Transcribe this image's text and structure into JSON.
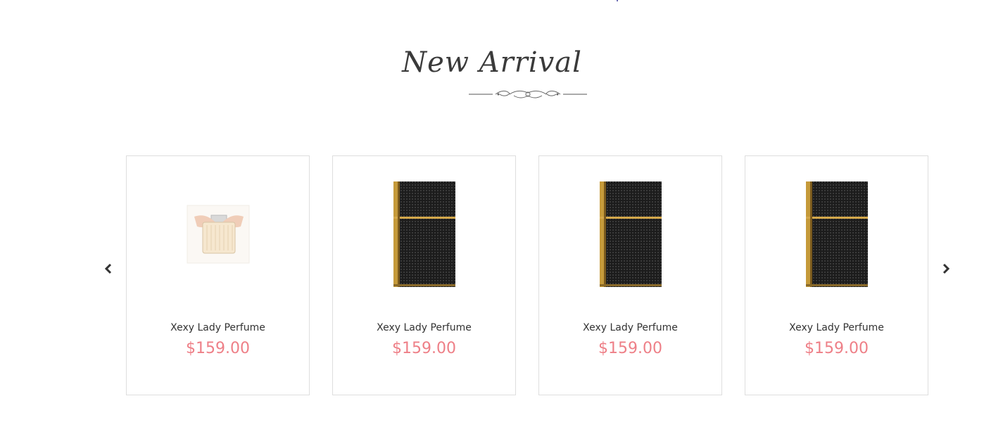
{
  "section": {
    "title": "New Arrival"
  },
  "carousel": {
    "prev_icon": "chevron-left-icon",
    "next_icon": "chevron-right-icon",
    "products": [
      {
        "name": "Xexy Lady Perfume",
        "price": "$159.00",
        "image": "perfume-bottle-clear"
      },
      {
        "name": "Xexy Lady Perfume",
        "price": "$159.00",
        "image": "perfume-bottle-black-gold"
      },
      {
        "name": "Xexy Lady Perfume",
        "price": "$159.00",
        "image": "perfume-bottle-black-gold"
      },
      {
        "name": "Xexy Lady Perfume",
        "price": "$159.00",
        "image": "perfume-bottle-black-gold"
      }
    ]
  },
  "colors": {
    "price": "#ee7f87",
    "title": "#3a3a3a",
    "card_border": "#dedede"
  }
}
